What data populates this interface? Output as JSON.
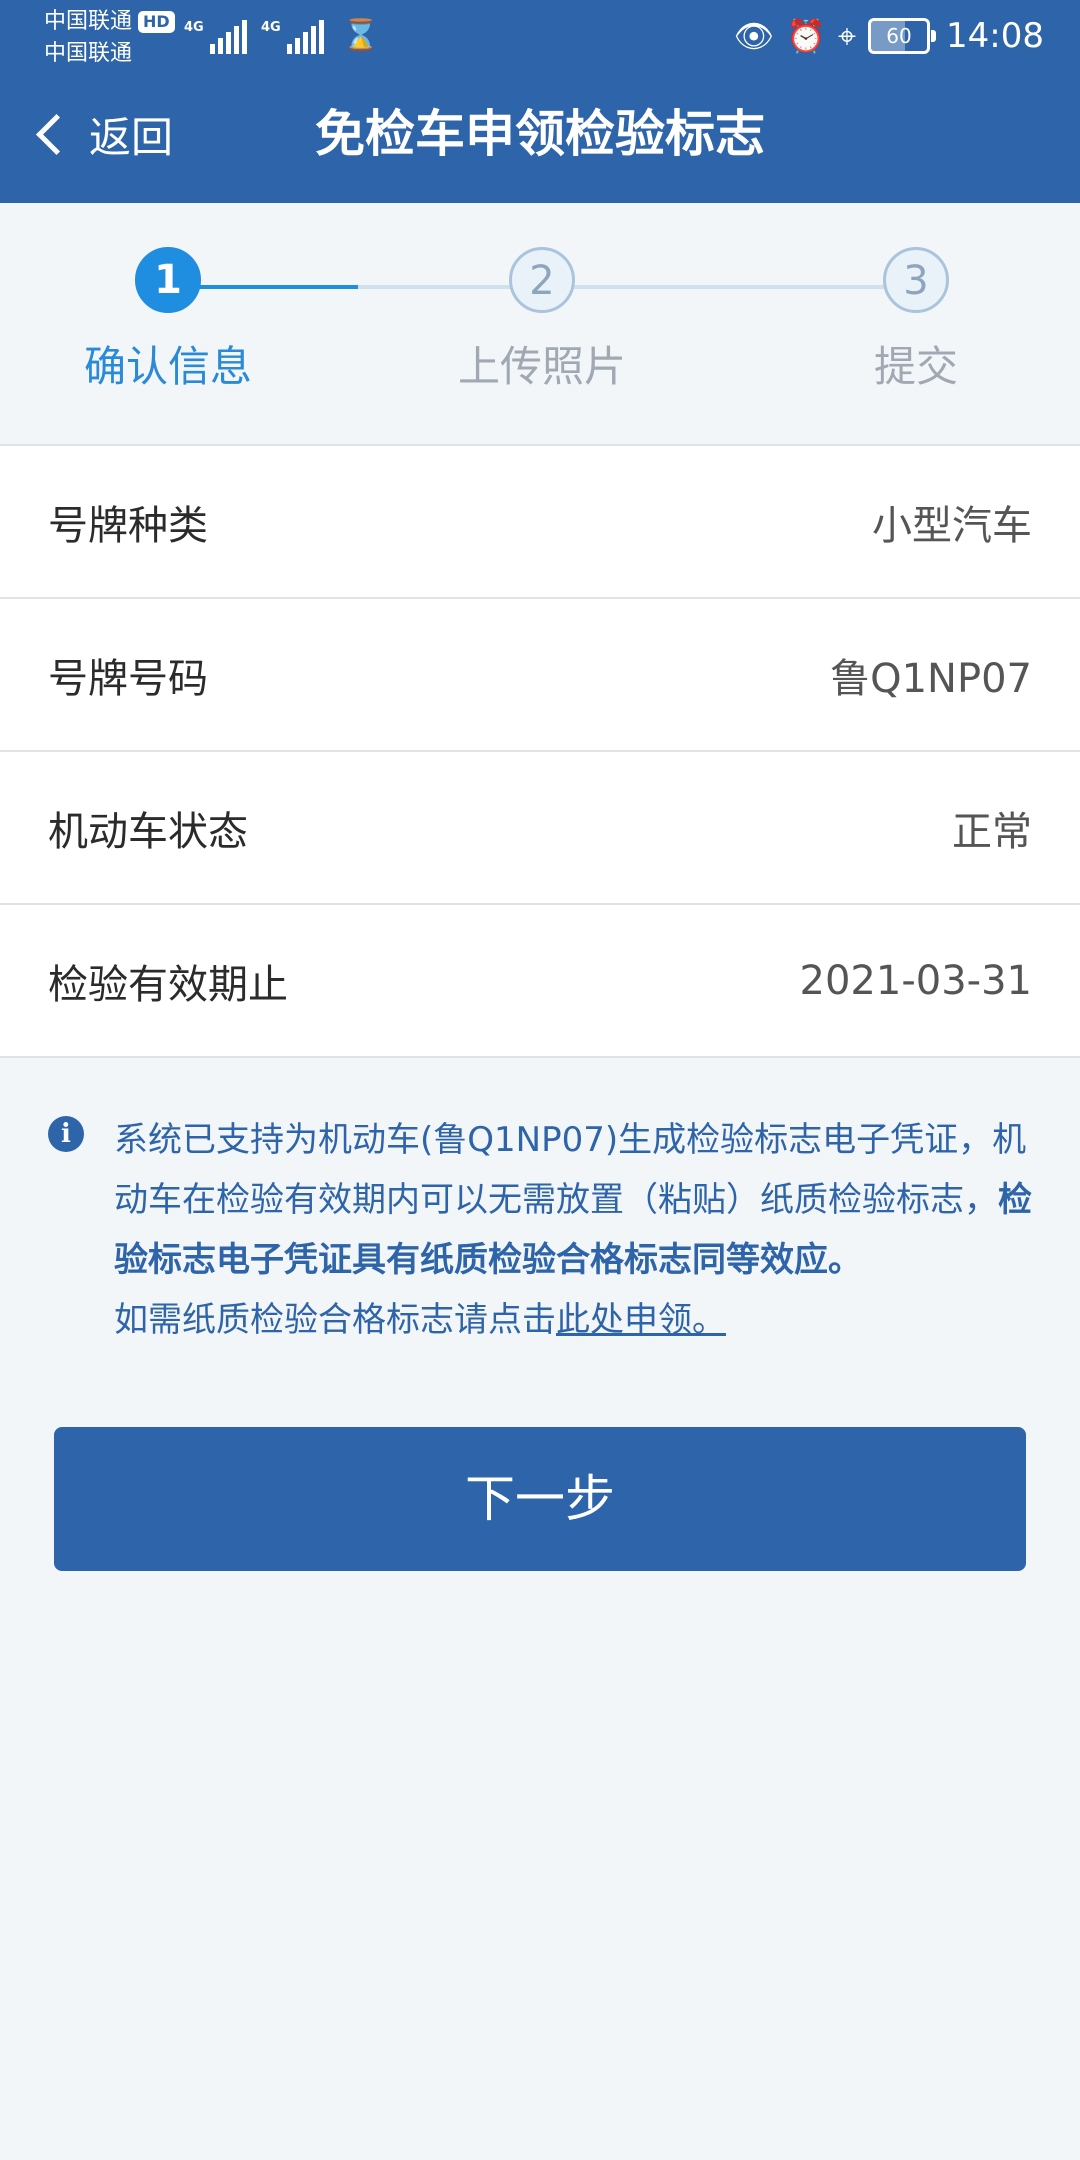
{
  "status_bar": {
    "carrier_1": "中国联通",
    "carrier_1_badge": "HD",
    "carrier_2": "中国联通",
    "network_1": "4G",
    "network_2": "4G",
    "battery_level": "60",
    "time": "14:08",
    "icons": [
      "eye-icon",
      "alarm-icon",
      "location-icon",
      "hourglass-icon"
    ]
  },
  "nav": {
    "back_label": "返回",
    "title": "免检车申领检验标志"
  },
  "steps": [
    {
      "number": "1",
      "label": "确认信息",
      "state": "active"
    },
    {
      "number": "2",
      "label": "上传照片",
      "state": "pending"
    },
    {
      "number": "3",
      "label": "提交",
      "state": "pending"
    }
  ],
  "info_rows": [
    {
      "label": "号牌种类",
      "value": "小型汽车"
    },
    {
      "label": "号牌号码",
      "value": "鲁Q1NP07"
    },
    {
      "label": "机动车状态",
      "value": "正常"
    },
    {
      "label": "检验有效期止",
      "value": "2021-03-31"
    }
  ],
  "notice": {
    "text_part1": "系统已支持为机动车(鲁Q1NP07)生成检验标志电子凭证，机动车在检验有效期内可以无需放置（粘贴）纸质检验标志，",
    "text_bold": "检验标志电子凭证具有纸质检验合格标志同等效应。",
    "text_part2": "如需纸质检验合格标志请点击",
    "link_text": "此处申领。"
  },
  "next_button_label": "下一步",
  "colors": {
    "primary": "#2e64a9",
    "step_active": "#1f8de0",
    "background": "#f3f6f8"
  }
}
